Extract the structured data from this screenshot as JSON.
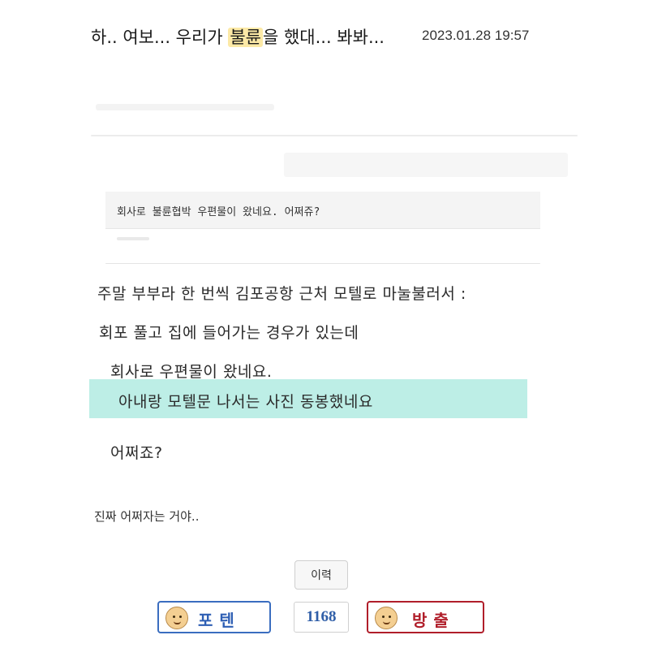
{
  "post": {
    "title_before": "하.. 여보... 우리가 ",
    "title_highlight": "불륜",
    "title_after": "을 했대... 봐봐...",
    "date": "2023.01.28 19:57"
  },
  "embedded": {
    "question": "회사로 불륜협박 우편물이 왔네요. 어쩌쥬?",
    "lines": [
      "주말 부부라 한 번씩 김포공항 근처 모텔로 마눌불러서 :",
      "회포 풀고 집에 들어가는 경우가 있는데",
      "회사로 우편물이 왔네요.",
      "아내랑 모텔문 나서는 사진 동봉했네요",
      "어쩌죠?"
    ]
  },
  "comment": "진짜 어쩌자는 거야..",
  "actions": {
    "history_label": "이력",
    "upvote_label": "포텐",
    "vote_count": "1168",
    "downvote_label": "방출",
    "upvote_icon": "thumbs-up-face-icon",
    "downvote_icon": "thumbs-down-face-icon"
  }
}
